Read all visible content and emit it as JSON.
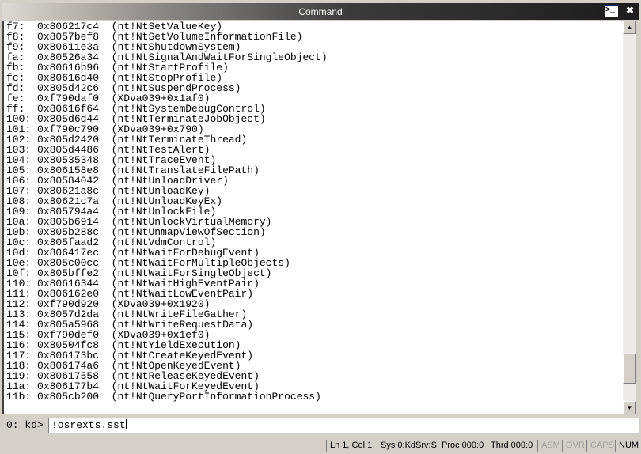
{
  "window": {
    "title": "Command",
    "icon": "command-prompt-icon",
    "close_icon": "close-icon"
  },
  "output_lines": [
    {
      "idx": "f7:",
      "addr": "0x806217c4",
      "sym": "(nt!NtSetValueKey)"
    },
    {
      "idx": "f8:",
      "addr": "0x8057bef8",
      "sym": "(nt!NtSetVolumeInformationFile)"
    },
    {
      "idx": "f9:",
      "addr": "0x80611e3a",
      "sym": "(nt!NtShutdownSystem)"
    },
    {
      "idx": "fa:",
      "addr": "0x80526a34",
      "sym": "(nt!NtSignalAndWaitForSingleObject)"
    },
    {
      "idx": "fb:",
      "addr": "0x80616b96",
      "sym": "(nt!NtStartProfile)"
    },
    {
      "idx": "fc:",
      "addr": "0x80616d40",
      "sym": "(nt!NtStopProfile)"
    },
    {
      "idx": "fd:",
      "addr": "0x805d42c6",
      "sym": "(nt!NtSuspendProcess)"
    },
    {
      "idx": "fe:",
      "addr": "0xf790daf0",
      "sym": "(XDva039+0x1af0)"
    },
    {
      "idx": "ff:",
      "addr": "0x80616f64",
      "sym": "(nt!NtSystemDebugControl)"
    },
    {
      "idx": "100:",
      "addr": "0x805d6d44",
      "sym": "(nt!NtTerminateJobObject)"
    },
    {
      "idx": "101:",
      "addr": "0xf790c790",
      "sym": "(XDva039+0x790)"
    },
    {
      "idx": "102:",
      "addr": "0x805d2420",
      "sym": "(nt!NtTerminateThread)"
    },
    {
      "idx": "103:",
      "addr": "0x805d4486",
      "sym": "(nt!NtTestAlert)"
    },
    {
      "idx": "104:",
      "addr": "0x80535348",
      "sym": "(nt!NtTraceEvent)"
    },
    {
      "idx": "105:",
      "addr": "0x806158e8",
      "sym": "(nt!NtTranslateFilePath)"
    },
    {
      "idx": "106:",
      "addr": "0x80584042",
      "sym": "(nt!NtUnloadDriver)"
    },
    {
      "idx": "107:",
      "addr": "0x80621a8c",
      "sym": "(nt!NtUnloadKey)"
    },
    {
      "idx": "108:",
      "addr": "0x80621c7a",
      "sym": "(nt!NtUnloadKeyEx)"
    },
    {
      "idx": "109:",
      "addr": "0x805794a4",
      "sym": "(nt!NtUnlockFile)"
    },
    {
      "idx": "10a:",
      "addr": "0x805b6914",
      "sym": "(nt!NtUnlockVirtualMemory)"
    },
    {
      "idx": "10b:",
      "addr": "0x805b288c",
      "sym": "(nt!NtUnmapViewOfSection)"
    },
    {
      "idx": "10c:",
      "addr": "0x805faad2",
      "sym": "(nt!NtVdmControl)"
    },
    {
      "idx": "10d:",
      "addr": "0x806417ec",
      "sym": "(nt!NtWaitForDebugEvent)"
    },
    {
      "idx": "10e:",
      "addr": "0x805c00cc",
      "sym": "(nt!NtWaitForMultipleObjects)"
    },
    {
      "idx": "10f:",
      "addr": "0x805bffe2",
      "sym": "(nt!NtWaitForSingleObject)"
    },
    {
      "idx": "110:",
      "addr": "0x80616344",
      "sym": "(nt!NtWaitHighEventPair)"
    },
    {
      "idx": "111:",
      "addr": "0x806162e0",
      "sym": "(nt!NtWaitLowEventPair)"
    },
    {
      "idx": "112:",
      "addr": "0xf790d920",
      "sym": "(XDva039+0x1920)"
    },
    {
      "idx": "113:",
      "addr": "0x8057d2da",
      "sym": "(nt!NtWriteFileGather)"
    },
    {
      "idx": "114:",
      "addr": "0x805a5968",
      "sym": "(nt!NtWriteRequestData)"
    },
    {
      "idx": "115:",
      "addr": "0xf790def0",
      "sym": "(XDva039+0x1ef0)"
    },
    {
      "idx": "116:",
      "addr": "0x80504fc8",
      "sym": "(nt!NtYieldExecution)"
    },
    {
      "idx": "117:",
      "addr": "0x806173bc",
      "sym": "(nt!NtCreateKeyedEvent)"
    },
    {
      "idx": "118:",
      "addr": "0x806174a6",
      "sym": "(nt!NtOpenKeyedEvent)"
    },
    {
      "idx": "119:",
      "addr": "0x80617558",
      "sym": "(nt!NtReleaseKeyedEvent)"
    },
    {
      "idx": "11a:",
      "addr": "0x806177b4",
      "sym": "(nt!NtWaitForKeyedEvent)"
    },
    {
      "idx": "11b:",
      "addr": "0x805cb200",
      "sym": "(nt!NtQueryPortInformationProcess)"
    }
  ],
  "scrollbar": {
    "position_percent": 95
  },
  "command": {
    "prompt": "0: kd>",
    "value": "!osrexts.sst"
  },
  "status": {
    "line_col": "Ln 1, Col 1",
    "sys": "Sys 0:KdSrv:S",
    "proc": "Proc 000:0",
    "thrd": "Thrd 000:0",
    "asm": "ASM",
    "ovr": "OVR",
    "caps": "CAPS",
    "num": "NUM"
  }
}
